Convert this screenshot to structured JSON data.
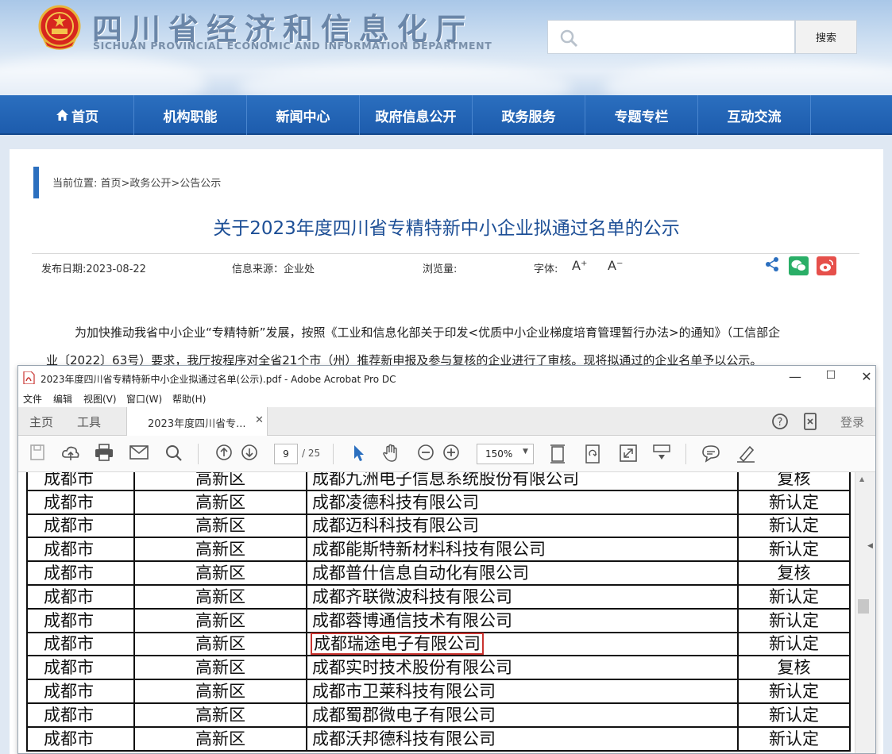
{
  "site": {
    "title": "四川省经济和信息化厅",
    "subtitle": "SICHUAN PROVINCIAL ECONOMIC AND INFORMATION DEPARTMENT",
    "search_button": "搜索"
  },
  "nav": {
    "items": [
      "首页",
      "机构职能",
      "新闻中心",
      "政府信息公开",
      "政务服务",
      "专题专栏",
      "互动交流"
    ]
  },
  "article": {
    "breadcrumb": "当前位置: 首页>政务公开>公告公示",
    "title": "关于2023年度四川省专精特新中小企业拟通过名单的公示",
    "publish_date": "发布日期:2023-08-22",
    "source": "信息来源：企业处",
    "views": "浏览量:",
    "font_label": "字体:",
    "font_up": "A⁺",
    "font_down": "A⁻",
    "para_line1": "为加快推动我省中小企业“专精特新”发展，按照《工业和信息化部关于印发<优质中小企业梯度培育管理暂行办法>的通知》（工信部企",
    "para_line2": "业〔2022〕63号）要求，我厅按程序对全省21个市（州）推荐新申报及参与复核的企业进行了审核。现将拟通过的企业名单予以公示。"
  },
  "acrobat": {
    "window_title": "2023年度四川省专精特新中小企业拟通过名单(公示).pdf - Adobe Acrobat Pro DC",
    "menu": [
      "文件",
      "编辑",
      "视图(V)",
      "窗口(W)",
      "帮助(H)"
    ],
    "tab_home": "主页",
    "tab_tools": "工具",
    "tab_doc": "2023年度四川省专...",
    "login": "登录",
    "page_current": "9",
    "page_total": "/ 25",
    "zoom": "150%"
  },
  "table": {
    "rows": [
      {
        "city": "成都市",
        "district": "高新区",
        "company": "成都九洲电子信息系统股份有限公司",
        "type": "复核"
      },
      {
        "city": "成都市",
        "district": "高新区",
        "company": "成都凌德科技有限公司",
        "type": "新认定"
      },
      {
        "city": "成都市",
        "district": "高新区",
        "company": "成都迈科科技有限公司",
        "type": "新认定"
      },
      {
        "city": "成都市",
        "district": "高新区",
        "company": "成都能斯特新材料科技有限公司",
        "type": "新认定"
      },
      {
        "city": "成都市",
        "district": "高新区",
        "company": "成都普什信息自动化有限公司",
        "type": "复核"
      },
      {
        "city": "成都市",
        "district": "高新区",
        "company": "成都齐联微波科技有限公司",
        "type": "新认定"
      },
      {
        "city": "成都市",
        "district": "高新区",
        "company": "成都蓉博通信技术有限公司",
        "type": "新认定"
      },
      {
        "city": "成都市",
        "district": "高新区",
        "company": "成都瑞途电子有限公司",
        "type": "新认定",
        "highlighted": true
      },
      {
        "city": "成都市",
        "district": "高新区",
        "company": "成都实时技术股份有限公司",
        "type": "复核"
      },
      {
        "city": "成都市",
        "district": "高新区",
        "company": "成都市卫莱科技有限公司",
        "type": "新认定"
      },
      {
        "city": "成都市",
        "district": "高新区",
        "company": "成都蜀郡微电子有限公司",
        "type": "新认定"
      },
      {
        "city": "成都市",
        "district": "高新区",
        "company": "成都沃邦德科技有限公司",
        "type": "新认定"
      }
    ]
  },
  "colors": {
    "nav_blue": "#1d5cad",
    "title_blue": "#1d4f96",
    "highlight_red": "#c9332f",
    "wechat_green": "#2aae67",
    "weibo_red": "#e6504b"
  }
}
